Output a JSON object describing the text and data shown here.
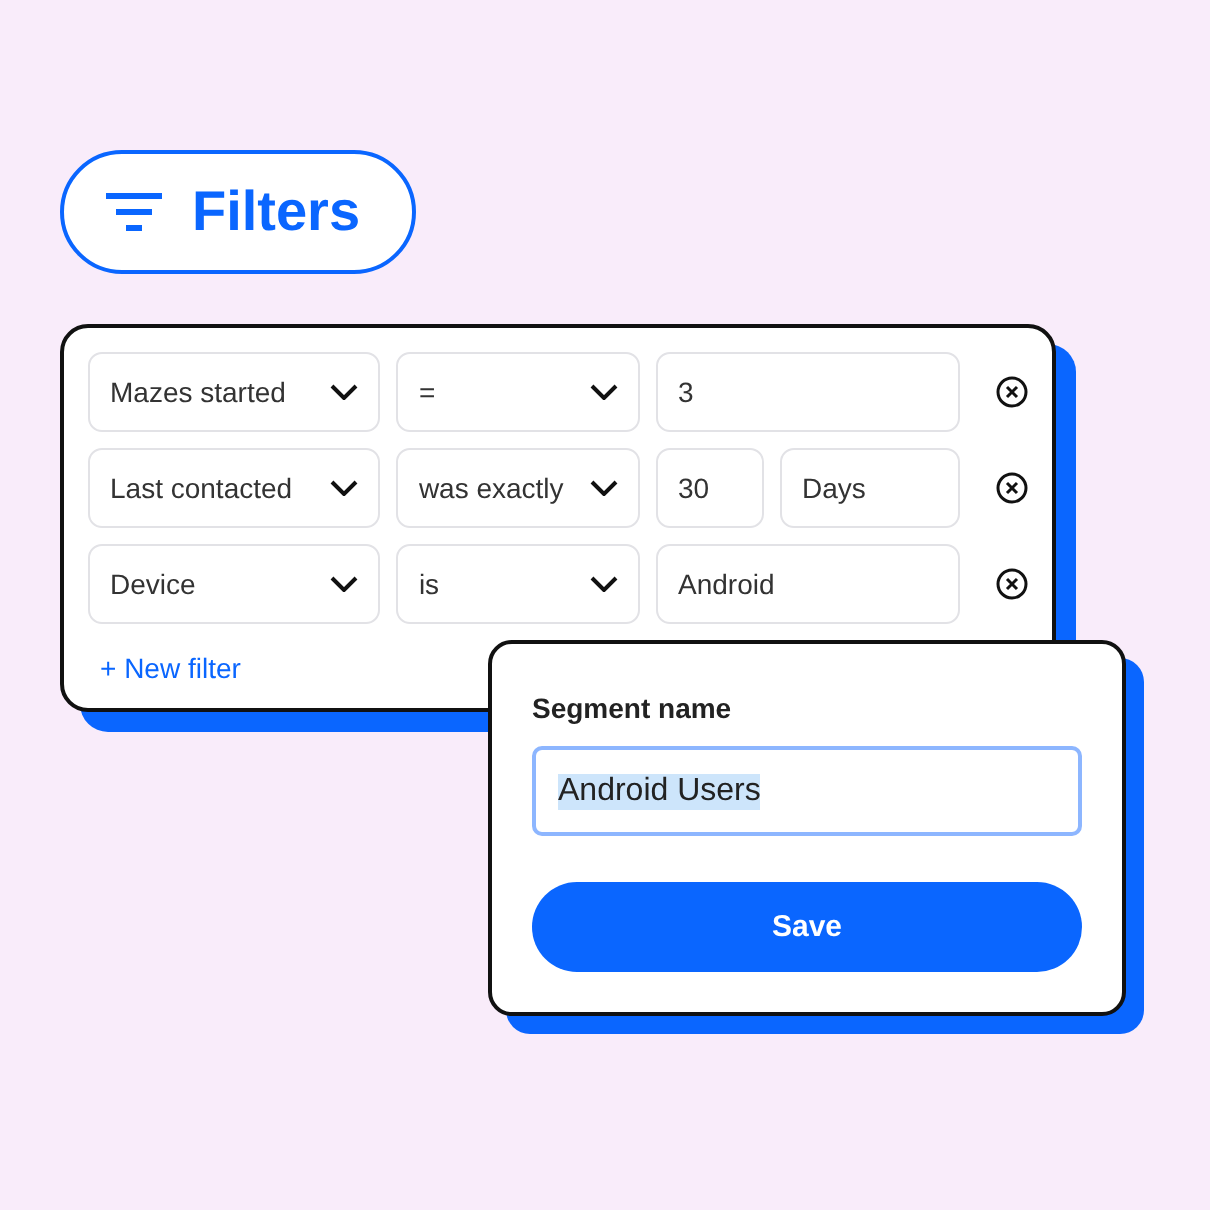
{
  "filters_button": {
    "label": "Filters"
  },
  "filters": [
    {
      "attribute": "Mazes started",
      "operator": "=",
      "values": [
        "3"
      ]
    },
    {
      "attribute": "Last contacted",
      "operator": "was exactly",
      "values": [
        "30",
        "Days"
      ]
    },
    {
      "attribute": "Device",
      "operator": "is",
      "values": [
        "Android"
      ]
    }
  ],
  "new_filter": "+ New filter",
  "segment": {
    "label": "Segment name",
    "value": "Android Users",
    "text_selected": true,
    "button": "Save"
  }
}
